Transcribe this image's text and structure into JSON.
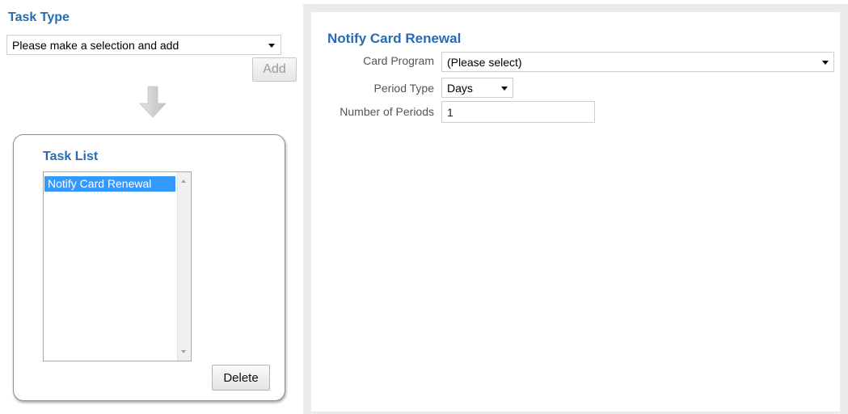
{
  "task_type": {
    "title": "Task Type",
    "select_value": "Please make a selection and add",
    "add_label": "Add"
  },
  "task_list": {
    "title": "Task List",
    "items": [
      {
        "label": "Notify Card Renewal",
        "selected": true
      }
    ],
    "delete_label": "Delete"
  },
  "detail": {
    "title": "Notify Card Renewal",
    "fields": {
      "card_program": {
        "label": "Card Program",
        "value": "(Please select)"
      },
      "period_type": {
        "label": "Period Type",
        "value": "Days"
      },
      "number_of_periods": {
        "label": "Number of Periods",
        "value": "1"
      }
    }
  },
  "colors": {
    "heading_blue": "#2a6bb0",
    "selection_blue": "#3399ff",
    "panel_gray": "#ebebeb"
  },
  "icons": {
    "flow_arrow": "arrow-down-icon",
    "dropdown": "chevron-down-icon"
  }
}
